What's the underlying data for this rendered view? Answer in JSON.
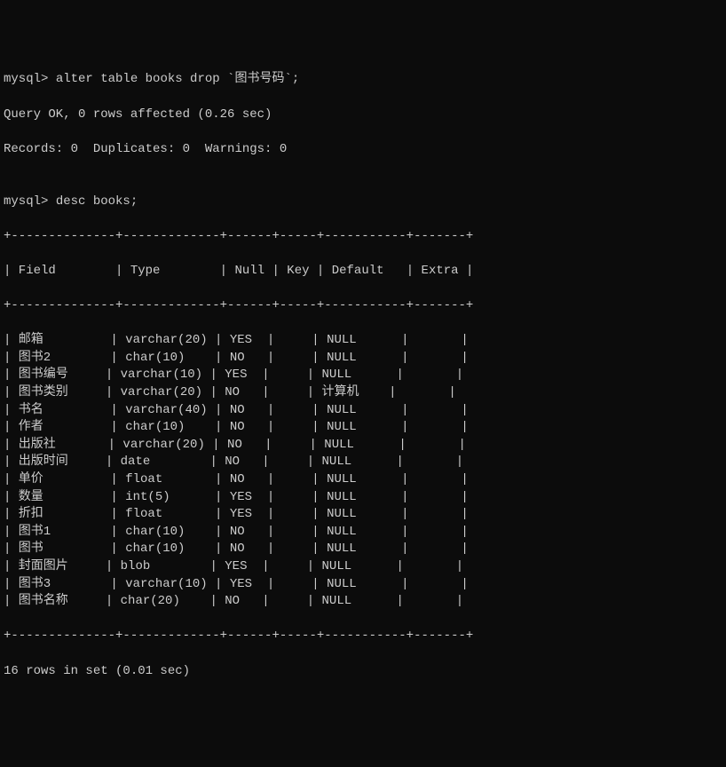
{
  "prompt1": "mysql>",
  "command1": " alter table books drop `图书号码`;",
  "response1_line1": "Query OK, 0 rows affected (0.26 sec)",
  "response1_line2": "Records: 0  Duplicates: 0  Warnings: 0",
  "blank": "",
  "prompt2": "mysql>",
  "command2": " desc books;",
  "border_top": "+--------------+-------------+------+-----+-----------+-------+",
  "header": {
    "pipe": "|",
    "field": " Field        ",
    "type": " Type        ",
    "null": " Null ",
    "key": " Key ",
    "default": " Default   ",
    "extra": " Extra "
  },
  "border_mid": "+--------------+-------------+------+-----+-----------+-------+",
  "rows": [
    {
      "field": "邮箱",
      "type": "varchar(20)",
      "null": "YES",
      "key": "",
      "default": "NULL",
      "extra": ""
    },
    {
      "field": "图书2",
      "type": "char(10)",
      "null": "NO",
      "key": "",
      "default": "NULL",
      "extra": ""
    },
    {
      "field": "图书编号",
      "type": "varchar(10)",
      "null": "YES",
      "key": "",
      "default": "NULL",
      "extra": ""
    },
    {
      "field": "图书类别",
      "type": "varchar(20)",
      "null": "NO",
      "key": "",
      "default": "计算机",
      "extra": ""
    },
    {
      "field": "书名",
      "type": "varchar(40)",
      "null": "NO",
      "key": "",
      "default": "NULL",
      "extra": ""
    },
    {
      "field": "作者",
      "type": "char(10)",
      "null": "NO",
      "key": "",
      "default": "NULL",
      "extra": ""
    },
    {
      "field": "出版社",
      "type": "varchar(20)",
      "null": "NO",
      "key": "",
      "default": "NULL",
      "extra": ""
    },
    {
      "field": "出版时间",
      "type": "date",
      "null": "NO",
      "key": "",
      "default": "NULL",
      "extra": ""
    },
    {
      "field": "单价",
      "type": "float",
      "null": "NO",
      "key": "",
      "default": "NULL",
      "extra": ""
    },
    {
      "field": "数量",
      "type": "int(5)",
      "null": "YES",
      "key": "",
      "default": "NULL",
      "extra": ""
    },
    {
      "field": "折扣",
      "type": "float",
      "null": "YES",
      "key": "",
      "default": "NULL",
      "extra": ""
    },
    {
      "field": "图书1",
      "type": "char(10)",
      "null": "NO",
      "key": "",
      "default": "NULL",
      "extra": ""
    },
    {
      "field": "图书",
      "type": "char(10)",
      "null": "NO",
      "key": "",
      "default": "NULL",
      "extra": ""
    },
    {
      "field": "封面图片",
      "type": "blob",
      "null": "YES",
      "key": "",
      "default": "NULL",
      "extra": ""
    },
    {
      "field": "图书3",
      "type": "varchar(10)",
      "null": "YES",
      "key": "",
      "default": "NULL",
      "extra": ""
    },
    {
      "field": "图书名称",
      "type": "char(20)",
      "null": "NO",
      "key": "",
      "default": "NULL",
      "extra": ""
    }
  ],
  "border_bot": "+--------------+-------------+------+-----+-----------+-------+",
  "footer": "16 rows in set (0.01 sec)",
  "chart_data": {
    "type": "table",
    "title": "desc books",
    "columns": [
      "Field",
      "Type",
      "Null",
      "Key",
      "Default",
      "Extra"
    ],
    "rows": [
      [
        "邮箱",
        "varchar(20)",
        "YES",
        "",
        "NULL",
        ""
      ],
      [
        "图书2",
        "char(10)",
        "NO",
        "",
        "NULL",
        ""
      ],
      [
        "图书编号",
        "varchar(10)",
        "YES",
        "",
        "NULL",
        ""
      ],
      [
        "图书类别",
        "varchar(20)",
        "NO",
        "",
        "计算机",
        ""
      ],
      [
        "书名",
        "varchar(40)",
        "NO",
        "",
        "NULL",
        ""
      ],
      [
        "作者",
        "char(10)",
        "NO",
        "",
        "NULL",
        ""
      ],
      [
        "出版社",
        "varchar(20)",
        "NO",
        "",
        "NULL",
        ""
      ],
      [
        "出版时间",
        "date",
        "NO",
        "",
        "NULL",
        ""
      ],
      [
        "单价",
        "float",
        "NO",
        "",
        "NULL",
        ""
      ],
      [
        "数量",
        "int(5)",
        "YES",
        "",
        "NULL",
        ""
      ],
      [
        "折扣",
        "float",
        "YES",
        "",
        "NULL",
        ""
      ],
      [
        "图书1",
        "char(10)",
        "NO",
        "",
        "NULL",
        ""
      ],
      [
        "图书",
        "char(10)",
        "NO",
        "",
        "NULL",
        ""
      ],
      [
        "封面图片",
        "blob",
        "YES",
        "",
        "NULL",
        ""
      ],
      [
        "图书3",
        "varchar(10)",
        "YES",
        "",
        "NULL",
        ""
      ],
      [
        "图书名称",
        "char(20)",
        "NO",
        "",
        "NULL",
        ""
      ]
    ]
  }
}
